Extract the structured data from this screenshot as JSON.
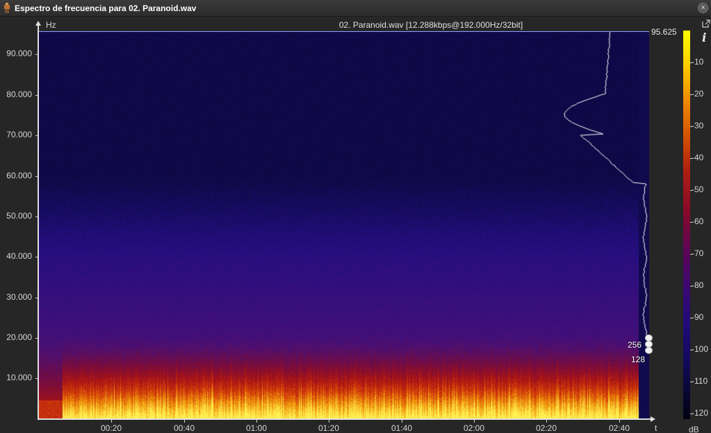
{
  "window": {
    "title": "Espectro de frecuencia para 02. Paranoid.wav",
    "close_glyph": "×"
  },
  "plot": {
    "file_info": "02. Paranoid.wav [12.288kbps@192.000Hz/32bit]",
    "y_unit": "Hz",
    "x_unit": "t",
    "nyquist_value": "95.625",
    "y_ticks": [
      "90.000",
      "80.000",
      "70.000",
      "60.000",
      "50.000",
      "40.000",
      "30.000",
      "20.000",
      "10.000"
    ],
    "x_ticks": [
      "00:20",
      "00:40",
      "01:00",
      "01:20",
      "01:40",
      "02:00",
      "02:20",
      "02:40"
    ],
    "fft_labels": [
      "256",
      "128"
    ]
  },
  "colorbar": {
    "unit": "dB",
    "ticks": [
      "-10",
      "-20",
      "-30",
      "-40",
      "-50",
      "-60",
      "-70",
      "-80",
      "-90",
      "-100",
      "-110",
      "-120"
    ],
    "info_glyph": "i"
  },
  "icons": {
    "app": "app-icon",
    "close": "close-icon",
    "popout": "popout-icon",
    "info": "info-icon"
  }
}
